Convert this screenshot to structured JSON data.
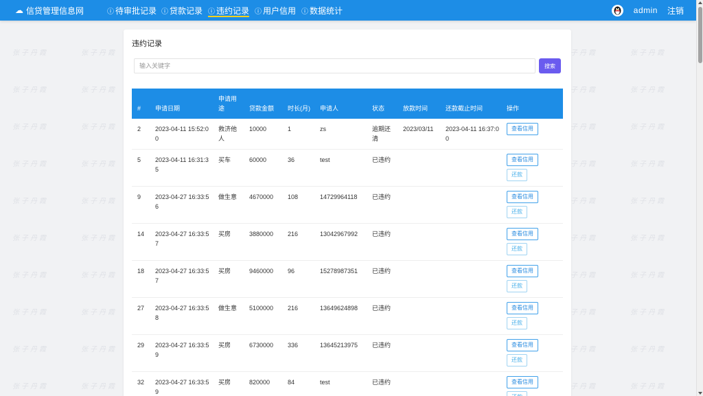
{
  "header": {
    "brand": "信贷管理信息网",
    "nav": [
      {
        "label": "待审批记录"
      },
      {
        "label": "贷款记录"
      },
      {
        "label": "违约记录"
      },
      {
        "label": "用户信用"
      },
      {
        "label": "数据统计"
      }
    ],
    "username": "admin",
    "logout": "注销"
  },
  "page": {
    "title": "违约记录",
    "search_placeholder": "输入关键字",
    "search_button": "搜索"
  },
  "watermark_text": "张子丹霞",
  "table": {
    "headers": [
      "#",
      "申请日期",
      "申请用途",
      "贷款金额",
      "时长(月)",
      "申请人",
      "状态",
      "放款时间",
      "还款截止时间",
      "操作"
    ],
    "rows": [
      {
        "id": "2",
        "date": "2023-04-11 15:52:00",
        "purpose": "救济他人",
        "amount": "10000",
        "months": "1",
        "applicant": "zs",
        "status": "逾期还清",
        "loan_time": "2023/03/11",
        "deadline": "2023-04-11 16:37:00",
        "actions": [
          "查看信用"
        ]
      },
      {
        "id": "5",
        "date": "2023-04-11 16:31:35",
        "purpose": "买车",
        "amount": "60000",
        "months": "36",
        "applicant": "test",
        "status": "已违约",
        "loan_time": "",
        "deadline": "",
        "actions": [
          "查看信用",
          "还款"
        ]
      },
      {
        "id": "9",
        "date": "2023-04-27 16:33:56",
        "purpose": "做生意",
        "amount": "4670000",
        "months": "108",
        "applicant": "14729964118",
        "status": "已违约",
        "loan_time": "",
        "deadline": "",
        "actions": [
          "查看信用",
          "还款"
        ]
      },
      {
        "id": "14",
        "date": "2023-04-27 16:33:57",
        "purpose": "买房",
        "amount": "3880000",
        "months": "216",
        "applicant": "13042967992",
        "status": "已违约",
        "loan_time": "",
        "deadline": "",
        "actions": [
          "查看信用",
          "还款"
        ]
      },
      {
        "id": "18",
        "date": "2023-04-27 16:33:57",
        "purpose": "买房",
        "amount": "9460000",
        "months": "96",
        "applicant": "15278987351",
        "status": "已违约",
        "loan_time": "",
        "deadline": "",
        "actions": [
          "查看信用",
          "还款"
        ]
      },
      {
        "id": "27",
        "date": "2023-04-27 16:33:58",
        "purpose": "做生意",
        "amount": "5100000",
        "months": "216",
        "applicant": "13649624898",
        "status": "已违约",
        "loan_time": "",
        "deadline": "",
        "actions": [
          "查看信用",
          "还款"
        ]
      },
      {
        "id": "29",
        "date": "2023-04-27 16:33:59",
        "purpose": "买房",
        "amount": "6730000",
        "months": "336",
        "applicant": "13645213975",
        "status": "已违约",
        "loan_time": "",
        "deadline": "",
        "actions": [
          "查看信用",
          "还款"
        ]
      },
      {
        "id": "32",
        "date": "2023-04-27 16:33:59",
        "purpose": "买房",
        "amount": "820000",
        "months": "84",
        "applicant": "test",
        "status": "已违约",
        "loan_time": "",
        "deadline": "",
        "actions": [
          "查看信用",
          "还款"
        ]
      }
    ]
  },
  "colors": {
    "navbar": "#1d8de6",
    "table_header": "#1d8de6",
    "search_button": "#6a5bef",
    "active_underline": "#ffd21f"
  }
}
